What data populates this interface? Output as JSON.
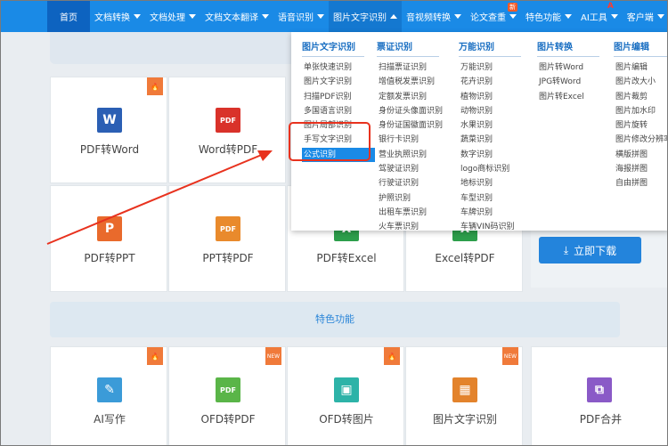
{
  "nav": {
    "items": [
      {
        "label": "首页",
        "caret": false
      },
      {
        "label": "文档转换",
        "caret": true
      },
      {
        "label": "文档处理",
        "caret": true
      },
      {
        "label": "文档文本翻译",
        "caret": true
      },
      {
        "label": "语音识别",
        "caret": true
      },
      {
        "label": "图片文字识别",
        "caret": true,
        "active": true
      },
      {
        "label": "音视频转换",
        "caret": true
      },
      {
        "label": "论文查重",
        "caret": true,
        "badge": "新"
      },
      {
        "label": "特色功能",
        "caret": true
      },
      {
        "label": "AI工具",
        "caret": true,
        "badge_ai": "A"
      },
      {
        "label": "客户端",
        "caret": true
      }
    ]
  },
  "dropdown": {
    "columns": [
      {
        "title": "图片文字识别",
        "items": [
          "单张快速识别",
          "图片文字识别",
          "扫描PDF识别",
          "多国语言识别",
          "图片局部识别",
          "手写文字识别",
          "公式识别"
        ],
        "selected": 6
      },
      {
        "title": "票证识别",
        "items": [
          "扫描票证识别",
          "增值税发票识别",
          "定额发票识别",
          "身份证头像面识别",
          "身份证国徽面识别",
          "银行卡识别",
          "营业执照识别",
          "驾驶证识别",
          "行驶证识别",
          "护照识别",
          "出租车票识别",
          "火车票识别"
        ]
      },
      {
        "title": "万能识别",
        "items": [
          "万能识别",
          "花卉识别",
          "植物识别",
          "动物识别",
          "水果识别",
          "蔬菜识别",
          "数字识别",
          "logo商标识别",
          "地标识别",
          "车型识别",
          "车牌识别",
          "车辆VIN码识别"
        ]
      },
      {
        "title": "图片转换",
        "items": [
          "图片转Word",
          "JPG转Word",
          "图片转Excel"
        ]
      },
      {
        "title": "图片编辑",
        "items": [
          "图片编辑",
          "图片改大小",
          "图片裁剪",
          "图片加水印",
          "图片旋转",
          "图片修改分辨率",
          "横版拼图",
          "海报拼图",
          "自由拼图"
        ]
      }
    ]
  },
  "grid": {
    "row1": [
      {
        "label": "PDF转Word",
        "tile": "W",
        "color": "#2b5fb4",
        "corner": "hot"
      },
      {
        "label": "Word转PDF",
        "tile": "PDF",
        "color": "#d9322a",
        "corner": ""
      }
    ],
    "row2": [
      {
        "label": "PDF转PPT",
        "tile": "P",
        "color": "#e96a2c"
      },
      {
        "label": "PPT转PDF",
        "tile": "PDF",
        "color": "#e98a2c"
      },
      {
        "label": "PDF转Excel",
        "tile": "X",
        "color": "#2d9e4b"
      },
      {
        "label": "Excel转PDF",
        "tile": "X",
        "color": "#2d9e4b"
      }
    ],
    "row3": [
      {
        "label": "AI写作",
        "tile": "✎",
        "color": "#3b9bd8",
        "corner": "hot"
      },
      {
        "label": "OFD转PDF",
        "tile": "PDF",
        "color": "#5ab548",
        "corner": "new"
      },
      {
        "label": "OFD转图片",
        "tile": "▣",
        "color": "#2db3a8",
        "corner": "hot"
      },
      {
        "label": "图片文字识别",
        "tile": "▦",
        "color": "#e3832c",
        "corner": "new"
      },
      {
        "label": "PDF合并",
        "tile": "⧉",
        "color": "#8a5ac7",
        "corner": ""
      }
    ]
  },
  "section_title": "特色功能",
  "download_label": "立即下载",
  "corner_text": {
    "hot": "🔥",
    "new": "NEW"
  },
  "colors": {
    "nav": "#1a8ae6",
    "accent": "#2384dc",
    "highlight": "#e8321e"
  }
}
